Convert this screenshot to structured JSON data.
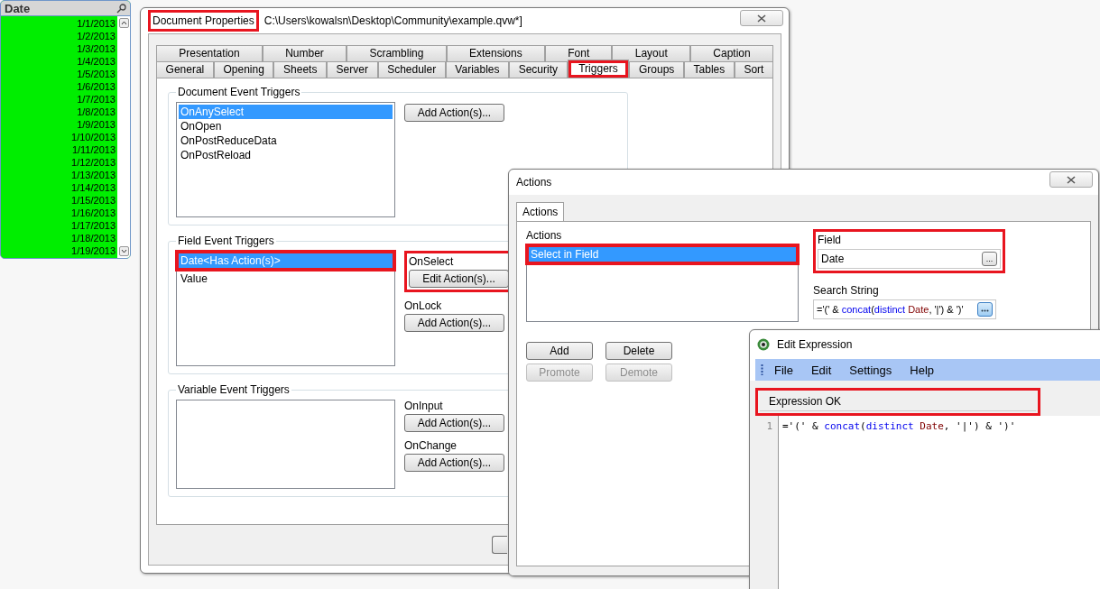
{
  "listbox": {
    "title": "Date",
    "rows": [
      "1/1/2013",
      "1/2/2013",
      "1/3/2013",
      "1/4/2013",
      "1/5/2013",
      "1/6/2013",
      "1/7/2013",
      "1/8/2013",
      "1/9/2013",
      "1/10/2013",
      "1/11/2013",
      "1/12/2013",
      "1/13/2013",
      "1/14/2013",
      "1/15/2013",
      "1/16/2013",
      "1/17/2013",
      "1/18/2013",
      "1/19/2013"
    ]
  },
  "document_properties": {
    "title": "Document Properties",
    "title_highlighted": true,
    "path": "C:\\Users\\kowalsn\\Desktop\\Community\\example.qvw*]",
    "tab_rows": [
      [
        {
          "label": "Presentation",
          "selected": false
        },
        {
          "label": "Number",
          "selected": false
        },
        {
          "label": "Scrambling",
          "selected": false
        },
        {
          "label": "Extensions",
          "selected": false
        },
        {
          "label": "Font",
          "selected": false
        },
        {
          "label": "Layout",
          "selected": false
        },
        {
          "label": "Caption",
          "selected": false
        }
      ],
      [
        {
          "label": "General",
          "selected": false
        },
        {
          "label": "Opening",
          "selected": false
        },
        {
          "label": "Sheets",
          "selected": false
        },
        {
          "label": "Server",
          "selected": false
        },
        {
          "label": "Scheduler",
          "selected": false
        },
        {
          "label": "Variables",
          "selected": false
        },
        {
          "label": "Security",
          "selected": false
        },
        {
          "label": "Triggers",
          "selected": true,
          "highlighted": true
        },
        {
          "label": "Groups",
          "selected": false
        },
        {
          "label": "Tables",
          "selected": false
        },
        {
          "label": "Sort",
          "selected": false
        }
      ]
    ],
    "groups": [
      {
        "title": "Document Event Triggers",
        "items": [
          {
            "label": "OnAnySelect",
            "selected": true
          },
          {
            "label": "OnOpen",
            "selected": false
          },
          {
            "label": "OnPostReduceData",
            "selected": false
          },
          {
            "label": "OnPostReload",
            "selected": false
          }
        ],
        "events": [
          {
            "button": "Add Action(s)..."
          }
        ]
      },
      {
        "title": "Field Event Triggers",
        "items": [
          {
            "label": "Date<Has Action(s)>",
            "selected": true,
            "highlighted": true
          },
          {
            "label": "Value",
            "selected": false
          }
        ],
        "events": [
          {
            "label": "OnSelect",
            "button": "Edit Action(s)...",
            "highlighted": true
          },
          {
            "label": "OnLock",
            "button": "Add Action(s)..."
          }
        ]
      },
      {
        "title": "Variable Event Triggers",
        "events": [
          {
            "label": "OnInput",
            "button": "Add Action(s)..."
          },
          {
            "label": "OnChange",
            "button": "Add Action(s)..."
          }
        ]
      }
    ]
  },
  "actions_dialog": {
    "title": "Actions",
    "tab": {
      "label": "Actions",
      "selected": true
    },
    "list_label": "Actions",
    "actions": [
      {
        "label": "Select in Field",
        "selected": true,
        "highlighted": true
      }
    ],
    "field": {
      "label": "Field",
      "value": "Date",
      "button": "...",
      "highlighted": true
    },
    "search_string": {
      "label": "Search String",
      "tokens": [
        {
          "text": "='(' & ",
          "kind": "plain"
        },
        {
          "text": "concat",
          "kind": "function"
        },
        {
          "text": "(",
          "kind": "plain"
        },
        {
          "text": "distinct",
          "kind": "function"
        },
        {
          "text": " Date",
          "kind": "field"
        },
        {
          "text": ", '|') & ')'",
          "kind": "plain"
        }
      ]
    },
    "buttons": [
      {
        "label": "Add",
        "disabled": false
      },
      {
        "label": "Delete",
        "disabled": false
      },
      {
        "label": "Promote",
        "disabled": true
      },
      {
        "label": "Demote",
        "disabled": true
      }
    ]
  },
  "edit_expression": {
    "title": "Edit Expression",
    "menu": [
      "File",
      "Edit",
      "Settings",
      "Help"
    ],
    "status": "Expression OK",
    "highlighted": true,
    "lines": [
      {
        "number": "1",
        "tokens": [
          {
            "text": "='(' & ",
            "kind": "plain"
          },
          {
            "text": "concat",
            "kind": "function"
          },
          {
            "text": "(",
            "kind": "plain"
          },
          {
            "text": "distinct",
            "kind": "function"
          },
          {
            "text": " Date",
            "kind": "field"
          },
          {
            "text": ", '|') & ')'",
            "kind": "plain"
          }
        ]
      }
    ]
  }
}
